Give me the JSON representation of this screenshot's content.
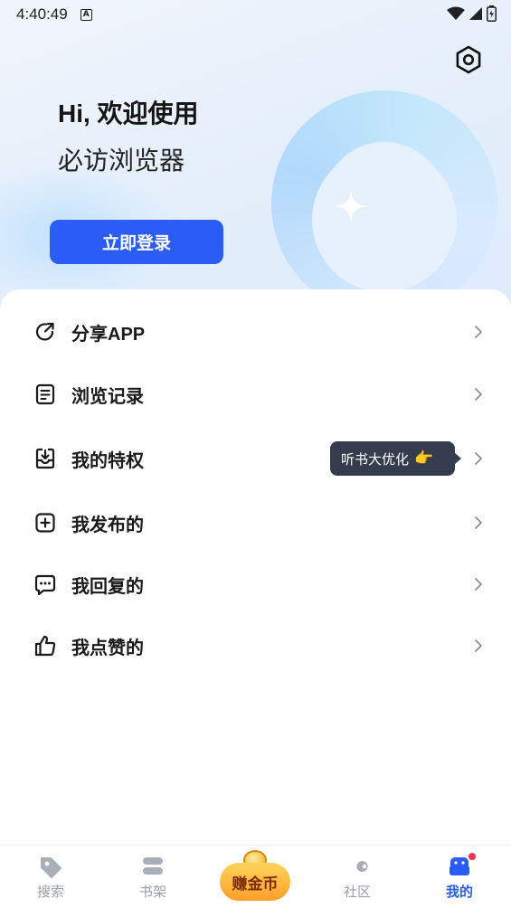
{
  "status_bar": {
    "time": "4:40:49",
    "notification_glyph": "A"
  },
  "hero": {
    "greeting": "Hi, 欢迎使用",
    "subtitle": "必访浏览器",
    "login_label": "立即登录"
  },
  "menu": {
    "items": [
      {
        "label": "分享APP",
        "icon": "share-icon"
      },
      {
        "label": "浏览记录",
        "icon": "history-icon"
      },
      {
        "label": "我的特权",
        "icon": "privilege-icon"
      },
      {
        "label": "我发布的",
        "icon": "add-post-icon"
      },
      {
        "label": "我回复的",
        "icon": "comment-icon"
      },
      {
        "label": "我点赞的",
        "icon": "thumbs-up-icon"
      }
    ],
    "privilege_tooltip": "听书大优化",
    "tooltip_emoji": "👉"
  },
  "tabbar": {
    "tabs": [
      {
        "label": "搜索",
        "icon": "tag-icon"
      },
      {
        "label": "书架",
        "icon": "bookshelf-icon"
      },
      {
        "label": "赚金币",
        "icon": "coin-icon"
      },
      {
        "label": "社区",
        "icon": "community-icon"
      },
      {
        "label": "我的",
        "icon": "profile-icon"
      }
    ],
    "active_tab": "我的"
  },
  "colors": {
    "accent": "#2b5cf5",
    "tooltip_bg": "#343c4e",
    "badge": "#f0335a",
    "tab_inactive": "#9aa0a8"
  }
}
